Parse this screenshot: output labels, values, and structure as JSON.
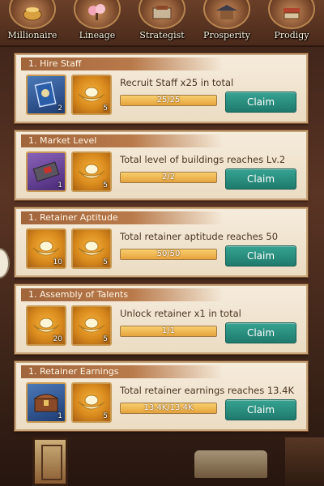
{
  "tabs": [
    {
      "label": "Millionaire",
      "icon": "gold-pot-icon"
    },
    {
      "label": "Lineage",
      "icon": "blossom-tree-icon"
    },
    {
      "label": "Strategist",
      "icon": "scroll-desk-icon"
    },
    {
      "label": "Prosperity",
      "icon": "pavilion-icon"
    },
    {
      "label": "Prodigy",
      "icon": "books-icon"
    }
  ],
  "quests": [
    {
      "header": "1. Hire Staff",
      "description": "Recruit Staff x25 in total",
      "progress_text": "25/25",
      "progress": 1.0,
      "claim_label": "Claim",
      "rewards": [
        {
          "icon": "staff-contract-icon",
          "qty": "2",
          "bg": "blue"
        },
        {
          "icon": "gold-ingot-icon",
          "qty": "5",
          "bg": "gold"
        }
      ]
    },
    {
      "header": "1. Market Level",
      "description": "Total level of buildings reaches Lv.2",
      "progress_text": "2/2",
      "progress": 1.0,
      "claim_label": "Claim",
      "rewards": [
        {
          "icon": "deed-book-icon",
          "qty": "1",
          "bg": "purple"
        },
        {
          "icon": "gold-ingot-icon",
          "qty": "5",
          "bg": "gold"
        }
      ]
    },
    {
      "header": "1. Retainer Aptitude",
      "description": "Total retainer aptitude reaches 50",
      "progress_text": "50/50",
      "progress": 1.0,
      "claim_label": "Claim",
      "rewards": [
        {
          "icon": "gold-ingot-icon",
          "qty": "10",
          "bg": "gold"
        },
        {
          "icon": "gold-ingot-icon",
          "qty": "5",
          "bg": "gold"
        }
      ]
    },
    {
      "header": "1. Assembly of Talents",
      "description": "Unlock  retainer x1 in total",
      "progress_text": "1/1",
      "progress": 1.0,
      "claim_label": "Claim",
      "rewards": [
        {
          "icon": "gold-ingot-icon",
          "qty": "20",
          "bg": "gold"
        },
        {
          "icon": "gold-ingot-icon",
          "qty": "5",
          "bg": "gold"
        }
      ]
    },
    {
      "header": "1. Retainer Earnings",
      "description": "Total retainer earnings reaches 13.4K",
      "progress_text": "13.4K/13.4K",
      "progress": 1.0,
      "claim_label": "Claim",
      "rewards": [
        {
          "icon": "treasure-chest-icon",
          "qty": "1",
          "bg": "blue"
        },
        {
          "icon": "gold-ingot-icon",
          "qty": "5",
          "bg": "gold"
        }
      ]
    }
  ]
}
